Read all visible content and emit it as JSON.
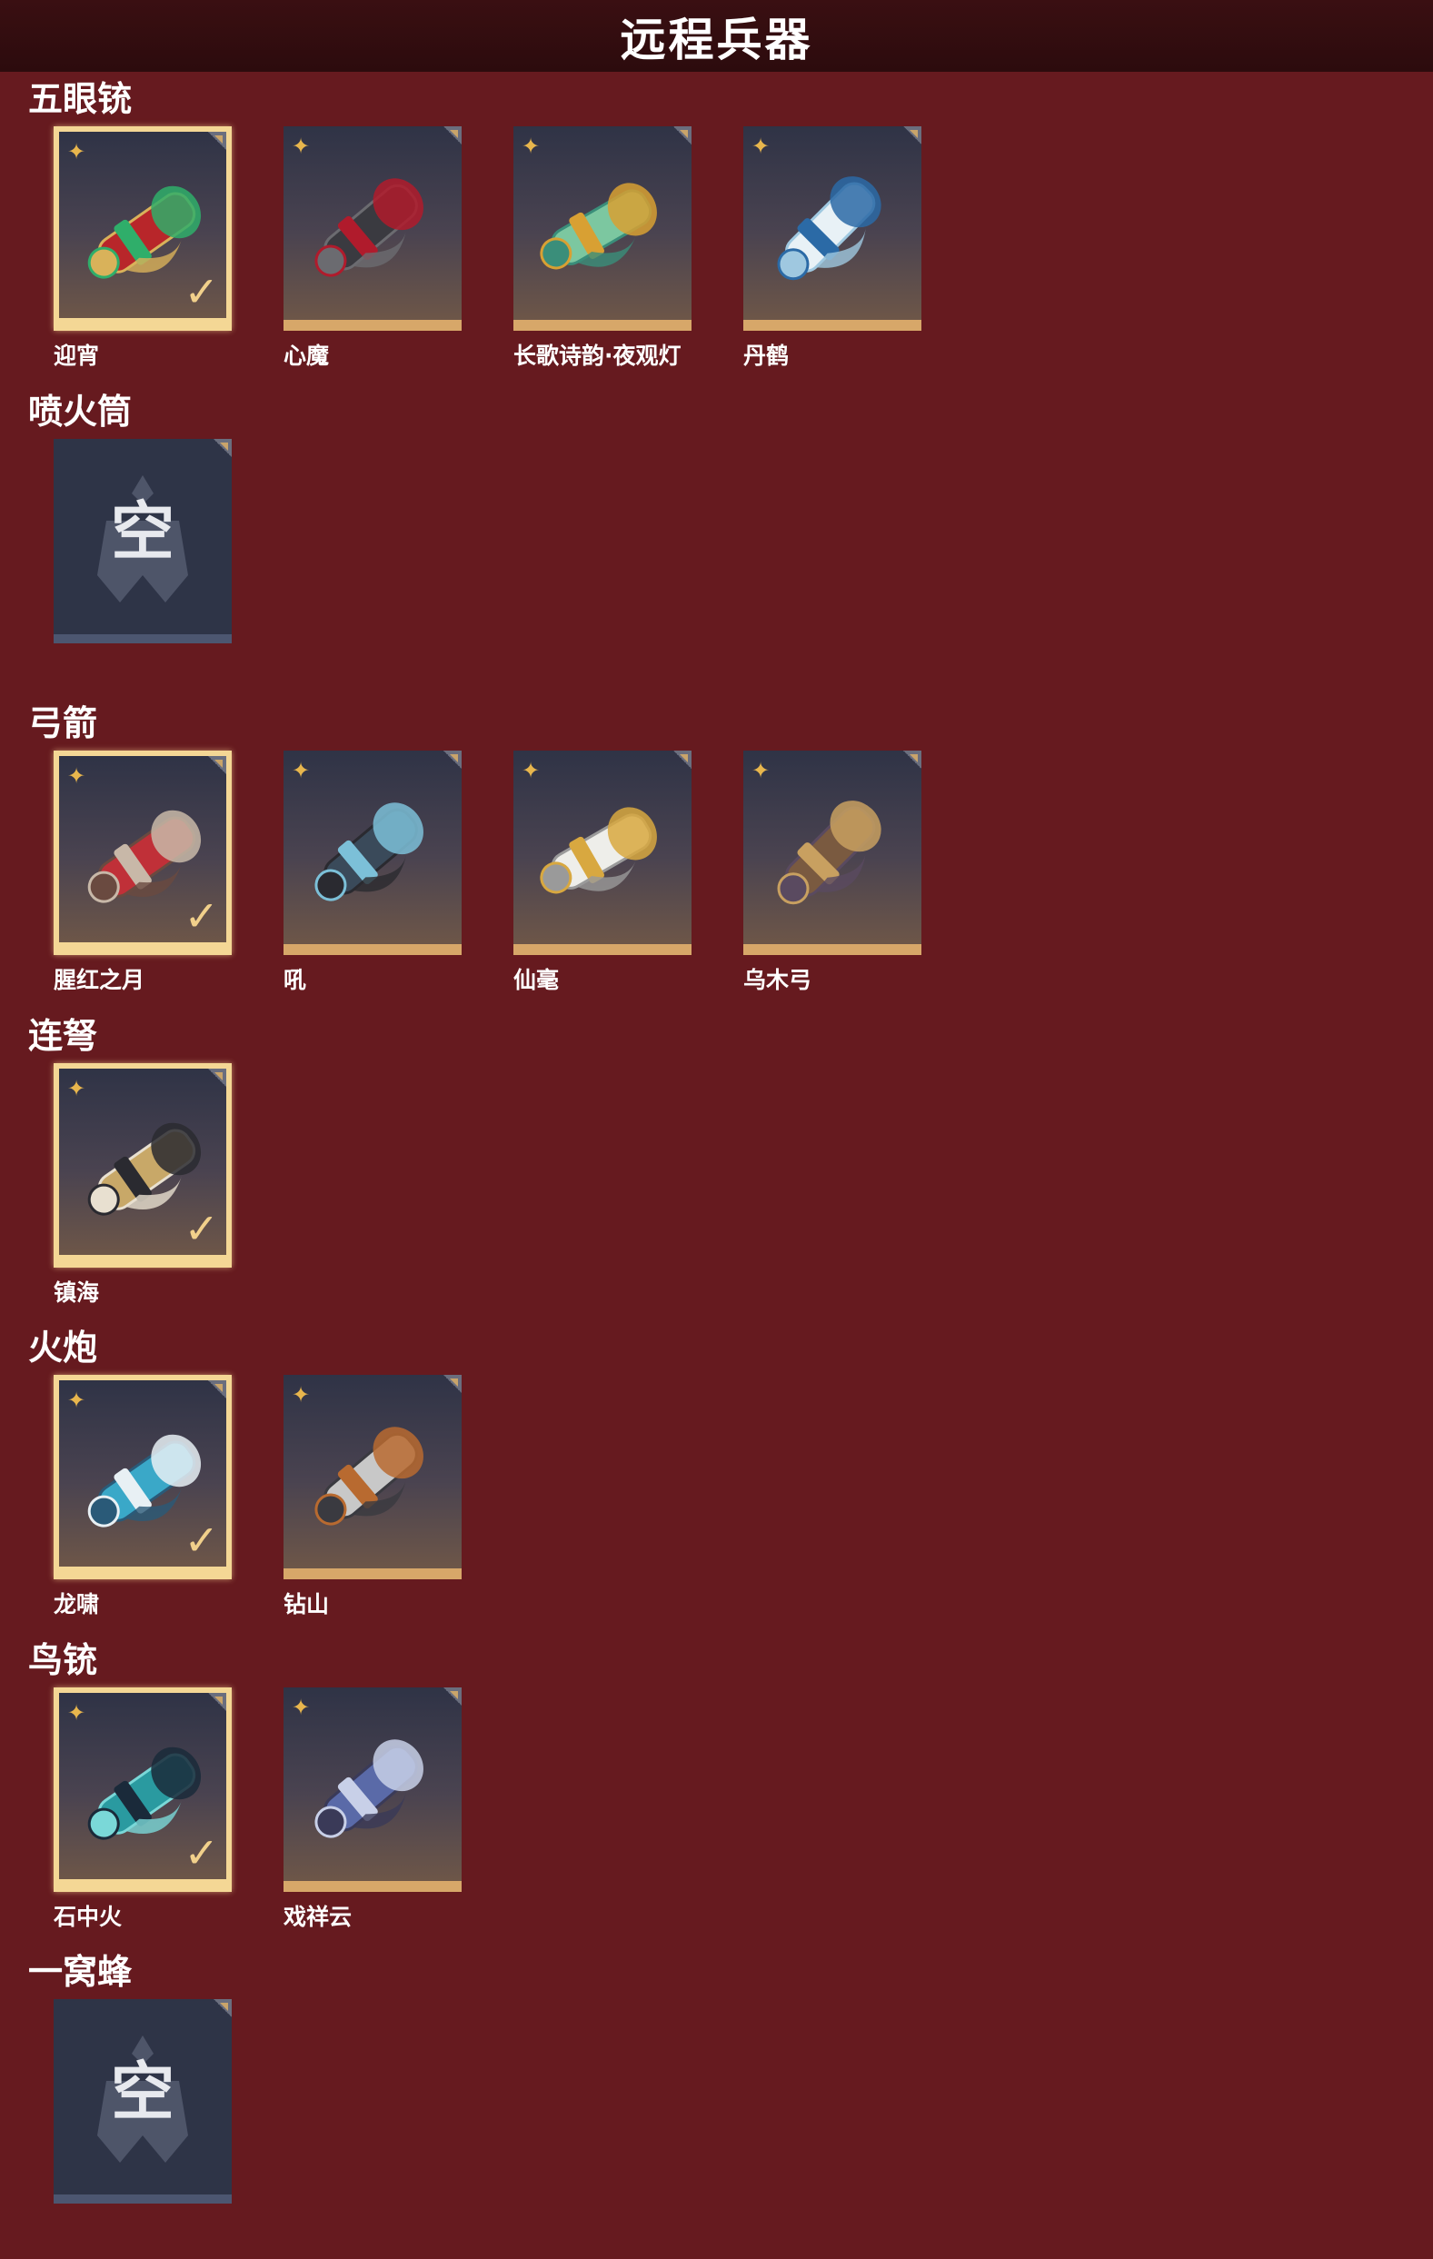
{
  "header": {
    "title": "远程兵器"
  },
  "sections": [
    {
      "title": "五眼铳",
      "items": [
        {
          "name": "迎宵",
          "selected": true,
          "palette": [
            "#b8262a",
            "#2fae6a",
            "#d9b25a"
          ]
        },
        {
          "name": "心魔",
          "selected": false,
          "palette": [
            "#3a3a40",
            "#b01b2c",
            "#6b6b70"
          ]
        },
        {
          "name": "长歌诗韵·夜观灯",
          "selected": false,
          "palette": [
            "#7cc7a0",
            "#d8a033",
            "#3a8e7a"
          ]
        },
        {
          "name": "丹鹤",
          "selected": false,
          "palette": [
            "#e8f1f6",
            "#2b6aa6",
            "#9fc8e0"
          ]
        }
      ]
    },
    {
      "title": "喷火筒",
      "items": [
        {
          "empty": true,
          "empty_label": "空"
        }
      ]
    },
    {
      "title": "弓箭",
      "items": [
        {
          "name": "腥红之月",
          "selected": true,
          "palette": [
            "#c03038",
            "#c8b8a8",
            "#6a4a40"
          ]
        },
        {
          "name": "吼",
          "selected": false,
          "palette": [
            "#3a4a5a",
            "#7cc0d8",
            "#2a2a30"
          ]
        },
        {
          "name": "仙毫",
          "selected": false,
          "palette": [
            "#eeeeea",
            "#d8a840",
            "#9a9a9a"
          ]
        },
        {
          "name": "乌木弓",
          "selected": false,
          "palette": [
            "#7a5a40",
            "#c8a060",
            "#5a4a60"
          ]
        }
      ]
    },
    {
      "title": "连弩",
      "items": [
        {
          "name": "镇海",
          "selected": true,
          "palette": [
            "#c8a868",
            "#2a2a30",
            "#e8e0d0"
          ]
        }
      ]
    },
    {
      "title": "火炮",
      "items": [
        {
          "name": "龙啸",
          "selected": true,
          "palette": [
            "#3aa8c8",
            "#e8f0f4",
            "#2a5a78"
          ]
        },
        {
          "name": "钻山",
          "selected": false,
          "palette": [
            "#c8c8c8",
            "#b86a30",
            "#3a3a40"
          ]
        }
      ]
    },
    {
      "title": "鸟铳",
      "items": [
        {
          "name": "石中火",
          "selected": true,
          "palette": [
            "#2a9aa0",
            "#1a2a3a",
            "#7ad8d8"
          ]
        },
        {
          "name": "戏祥云",
          "selected": false,
          "palette": [
            "#5a6aa8",
            "#c8d0e8",
            "#3a3a58"
          ]
        }
      ]
    },
    {
      "title": "一窝蜂",
      "items": [
        {
          "empty": true,
          "empty_label": "空"
        }
      ]
    }
  ]
}
